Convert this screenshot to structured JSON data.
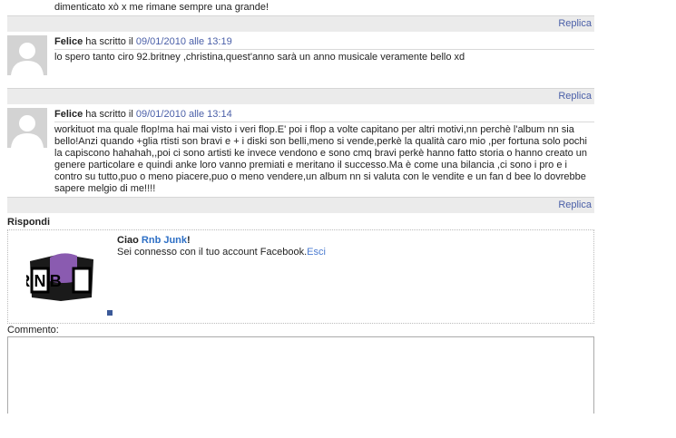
{
  "top_text": "dimenticato xò x me rimane sempre una grande!",
  "reply_label": "Replica",
  "comments": [
    {
      "author": "Felice",
      "wrote": "ha scritto il",
      "date": "09/01/2010 alle 13:19",
      "text": "lo spero tanto ciro 92.britney ,christina,quest'anno sarà un anno musicale veramente bello xd"
    },
    {
      "author": "Felice",
      "wrote": "ha scritto il",
      "date": "09/01/2010 alle 13:14",
      "text": "workituot ma quale flop!ma hai mai visto i veri flop.E' poi i flop a volte capitano per altri motivi,nn perchè l'album nn sia bello!Anzi quando +glia rtisti son bravi e + i diski son belli,meno si vende,perkè la qualità caro mio ,per fortuna solo pochi la capiscono hahahah,,poi ci sono artisti ke invece vendono e sono cmq bravi perkè hanno fatto storia o hanno creato un genere particolare e quindi anke loro vanno premiati e meritano il successo.Ma è come una bilancia ,ci sono i pro e i contro su tutto,puo o meno piacere,puo o meno vendere,un album nn si valuta con le vendite e un fan d bee lo dovrebbe sapere melgio di me!!!!"
    }
  ],
  "respond": {
    "title": "Rispondi",
    "greeting": "Ciao",
    "username": "Rnb Junk",
    "excl": "!",
    "connected_text": "Sei connesso con il tuo account Facebook.",
    "logout": "Esci",
    "logo_text": "R'N'B"
  },
  "comment_label": "Commento:",
  "colors": {
    "link": "#4a5fa8",
    "reply_bg": "#ebebeb",
    "fb_blue": "#3b5998"
  }
}
